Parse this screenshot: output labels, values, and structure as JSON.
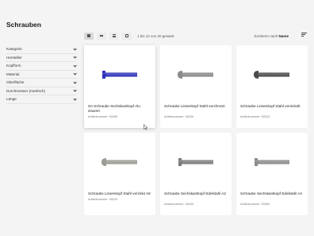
{
  "page": {
    "title": "Schrauben"
  },
  "filters": [
    {
      "label": "Kategorie"
    },
    {
      "label": "Hersteller"
    },
    {
      "label": "Kopfform"
    },
    {
      "label": "Material"
    },
    {
      "label": "Oberfläche"
    },
    {
      "label": "Durchmesser (metrisch)"
    },
    {
      "label": "Länge"
    }
  ],
  "toolbar": {
    "result_count": "1 bis 12 von 20 gesamt",
    "sort_prefix": "Sortieren nach",
    "sort_value": "Name"
  },
  "products": [
    {
      "name": "SA Schraube Sechskantkopf Alu eloxiert",
      "article": "Artikelnummer: 90260",
      "color": "#2f33b8",
      "head": "hex"
    },
    {
      "name": "Schraube Linsenkopf Stahl verchromt",
      "article": "Artikelnummer: 90230",
      "color": "#8a8a8a",
      "head": "round"
    },
    {
      "name": "Schraube Linsenkopf Stahl vernickelt",
      "article": "Artikelnummer: 90220",
      "color": "#4a4a4a",
      "head": "round"
    },
    {
      "name": "Schraube Linsenkopf Stahl verzinkt A8",
      "article": "Artikelnummer: 90210",
      "color": "#9c9c94",
      "head": "round"
    },
    {
      "name": "Schraube Sechskantkopf Edelstahl A2",
      "article": "Artikelnummer: 90340",
      "color": "#7d7d7d",
      "head": "hex"
    },
    {
      "name": "Schraube Sechskantkopf Edelstahl A4",
      "article": "Artikelnummer: 90350",
      "color": "#8c8c8c",
      "head": "hex"
    }
  ]
}
